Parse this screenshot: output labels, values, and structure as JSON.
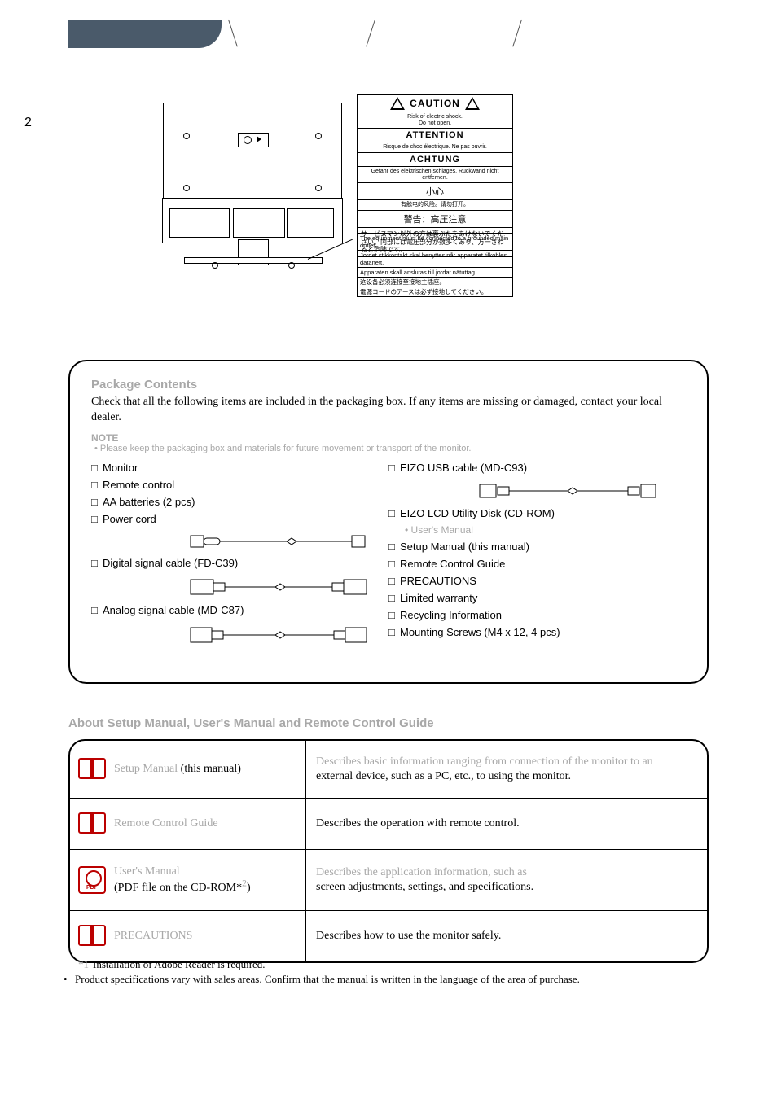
{
  "page_number_side": "2",
  "caution_label": {
    "caution_en": "CAUTION",
    "caution_sub_en": "Risk of electric shock.\nDo not open.",
    "attention": "ATTENTION",
    "attention_sub": "Risque de choc électrique. Ne pas ouvrir.",
    "achtung": "ACHTUNG",
    "achtung_sub": "Gefahr des elektrischen schlages. Rückwand nicht entfernen.",
    "cn_head": "小心",
    "cn_sub": "有触电的风险。请勿打开。",
    "jp_head": "警告：高圧注意",
    "jp_body": "サービスマン以外の方は裏ぶたをあけないでください。内部には電圧部分が数多くあり、万一さわると危険です。"
  },
  "outlet_notice": {
    "l1": "The equipment must be connected to a grounded main outlet.",
    "l2": "Jordet stikkontakt skal benyttes når apparatet tilkobles datanett.",
    "l3": "Apparaten skall anslutas till jordat nätuttag.",
    "l4": "这设备必须连接至接地主插座。",
    "l5": "電源コードのアースは必ず接地してください。"
  },
  "package": {
    "title": "Package Contents",
    "intro": "Check that all the following items are included in the packaging box. If any items are missing or damaged, contact your local dealer.",
    "note_head": "NOTE",
    "note_body": "• Please keep the packaging box and materials for future movement or transport of the monitor.",
    "left": {
      "i1": "Monitor",
      "i2": "Remote control",
      "i3": "AA batteries (2 pcs)",
      "i4": "Power cord",
      "i5": "Digital signal cable (FD-C39)",
      "i6": "Analog signal cable (MD-C87)"
    },
    "right": {
      "i1": "EIZO USB cable (MD-C93)",
      "i2": "EIZO LCD Utility Disk (CD-ROM)",
      "i2s": "• User's Manual",
      "i3": "Setup Manual (this manual)",
      "i4": "Remote Control Guide",
      "i5": "PRECAUTIONS",
      "i6": "Limited warranty",
      "i7": "Recycling Information",
      "i8": "Mounting Screws (M4 x 12, 4 pcs)"
    }
  },
  "manuals_heading": "About Setup Manual, User's Manual and Remote Control Guide",
  "table": {
    "r1": {
      "left_main": "Setup Manual",
      "left_note": "(this manual)",
      "right_l1": "Describes basic information ranging from connection of the monitor to an",
      "right_l2": "external device, such as a PC, etc., to using the monitor."
    },
    "r2": {
      "left_main": "Remote Control Guide",
      "right": "Describes the operation with remote control."
    },
    "r3": {
      "left_main": "User's Manual",
      "left_note_prefix": "(PDF file on the CD-ROM*",
      "left_note_sup": "2",
      "left_note_suffix": ")",
      "right_l1": "Describes the application information, such as",
      "right_l2": "screen adjustments, settings, and specifications."
    },
    "r4": {
      "left_main": "PRECAUTIONS",
      "right": "Describes how to use the monitor safely."
    }
  },
  "footnotes": {
    "f1_mark": "*1",
    "f1_text": "Installation of Adobe Reader is required.",
    "f2_bullet": "•",
    "f2_text": "Product specifications vary with sales areas. Confirm that the manual is written in the language of the area of purchase."
  }
}
